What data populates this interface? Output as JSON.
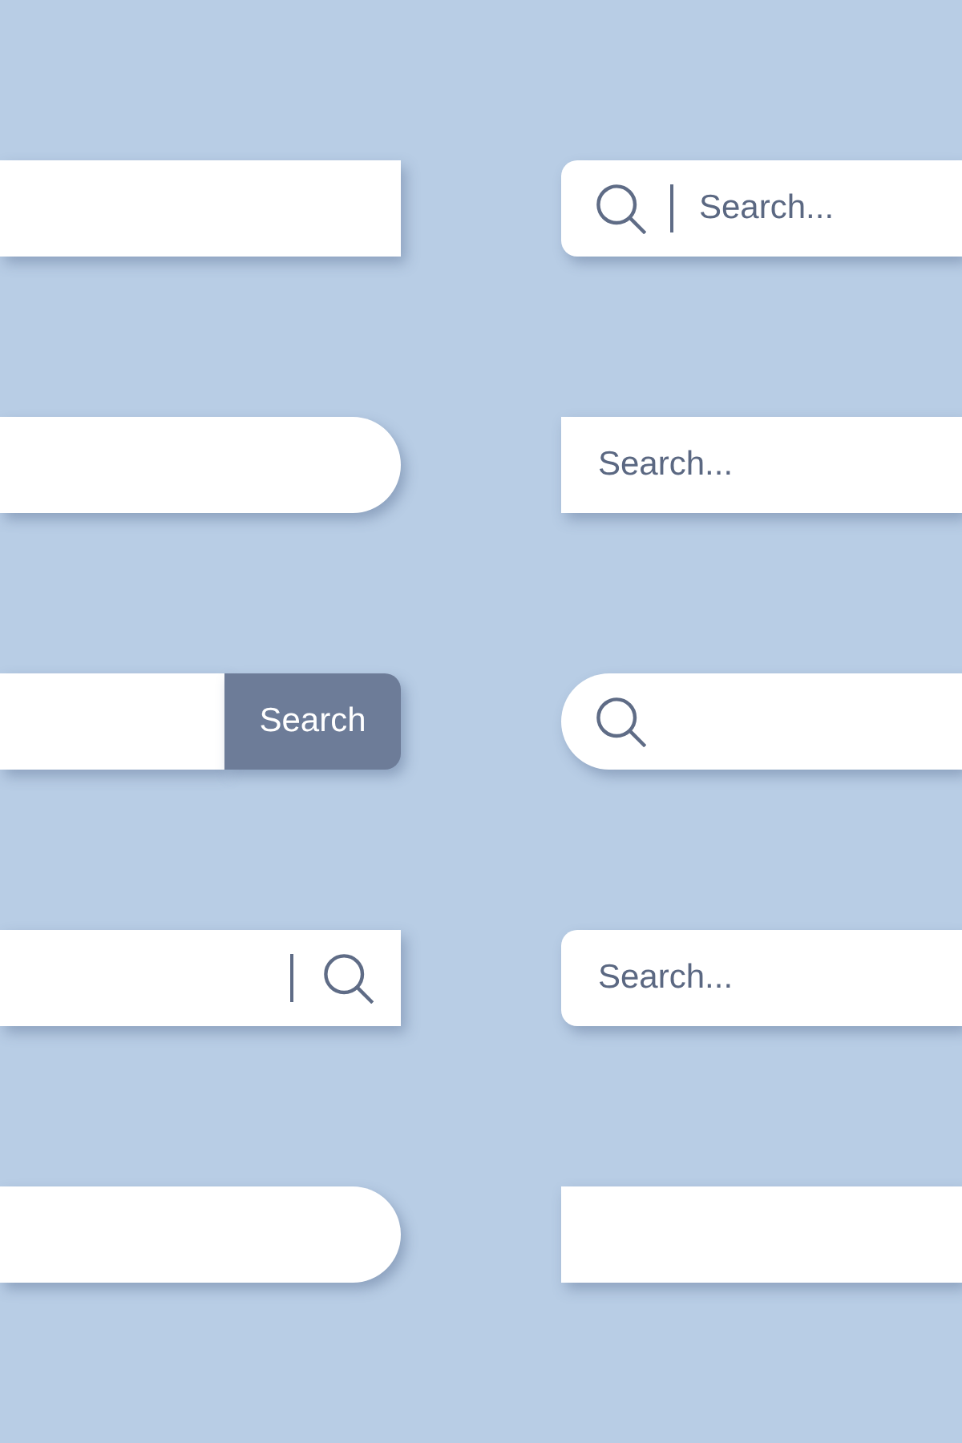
{
  "search_bars": [
    {
      "kind": "plain"
    },
    {
      "kind": "leading",
      "placeholder": "Search..."
    },
    {
      "kind": "capsule"
    },
    {
      "kind": "plain",
      "placeholder": "Search..."
    },
    {
      "kind": "button",
      "button": "Search"
    },
    {
      "kind": "lens"
    },
    {
      "kind": "trailing"
    },
    {
      "kind": "soft",
      "placeholder": "Search..."
    },
    {
      "kind": "capsule"
    },
    {
      "kind": "plain"
    }
  ]
}
